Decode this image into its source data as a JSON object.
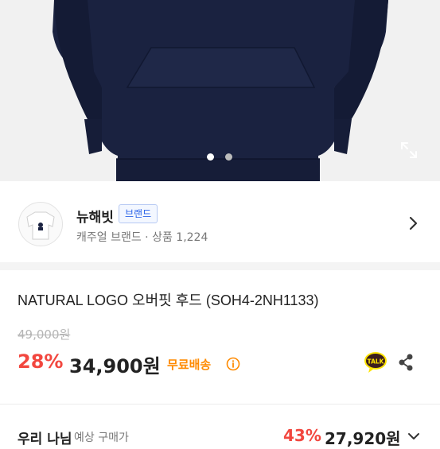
{
  "gallery": {
    "page_count": 2,
    "active_index": 0
  },
  "brand": {
    "name": "뉴해빗",
    "badge": "브랜드",
    "subtitle": "캐주얼 브랜드 · 상품 1,224"
  },
  "product": {
    "title": "NATURAL LOGO 오버핏 후드 (SOH4-2NH1133)",
    "original_price": "49,000원",
    "discount_rate": "28%",
    "price": "34,900원",
    "shipping": "무료배송",
    "share_label": "TALK"
  },
  "member_price": {
    "label": "우리 나님",
    "sublabel": "예상 구매가",
    "discount_rate": "43%",
    "price": "27,920원"
  },
  "colors": {
    "accent_red": "#f2473f",
    "shipping_orange": "#ff8a00",
    "hoodie_navy": "#1a2240",
    "badge_blue": "#2a63e8",
    "kakao_yellow": "#fee500"
  },
  "icons": [
    "expand-icon",
    "chevron-right-icon",
    "info-icon",
    "kakao-talk-icon",
    "share-icon",
    "chevron-down-icon"
  ]
}
